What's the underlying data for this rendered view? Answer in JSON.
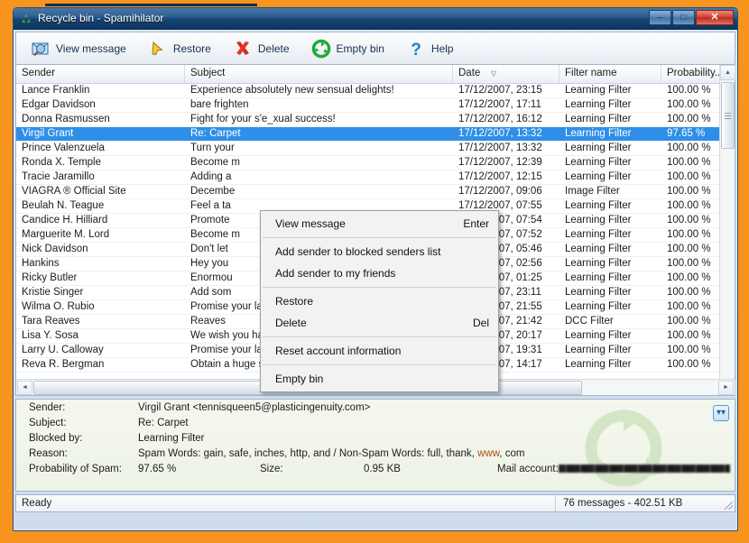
{
  "window": {
    "title": "Recycle bin - Spamihilator",
    "icon": "recycle-icon",
    "minimize": "–",
    "maximize": "□",
    "close": "✕"
  },
  "toolbar": {
    "buttons": [
      {
        "label": "View message",
        "icon": "view-message-icon"
      },
      {
        "label": "Restore",
        "icon": "restore-arrow-icon"
      },
      {
        "label": "Delete",
        "icon": "delete-x-icon"
      },
      {
        "label": "Empty bin",
        "icon": "empty-bin-recycle-icon"
      },
      {
        "label": "Help",
        "icon": "help-question-icon"
      }
    ]
  },
  "list": {
    "columns": [
      {
        "key": "sender",
        "label": "Sender",
        "sorted": false
      },
      {
        "key": "subject",
        "label": "Subject",
        "sorted": false
      },
      {
        "key": "date",
        "label": "Date",
        "sorted": true
      },
      {
        "key": "filter",
        "label": "Filter name",
        "sorted": false
      },
      {
        "key": "probability",
        "label": "Probability...",
        "sorted": false
      }
    ],
    "rows": [
      {
        "sender": "Lance Franklin",
        "subject": "Experience absolutely new sensual delights!",
        "date": "17/12/2007, 23:15",
        "filter": "Learning Filter",
        "probability": "100.00 %",
        "selected": false
      },
      {
        "sender": "Edgar Davidson",
        "subject": "bare frighten",
        "date": "17/12/2007, 17:11",
        "filter": "Learning Filter",
        "probability": "100.00 %",
        "selected": false
      },
      {
        "sender": "Donna Rasmussen",
        "subject": "Fight for your s'e_xual success!",
        "date": "17/12/2007, 16:12",
        "filter": "Learning Filter",
        "probability": "100.00 %",
        "selected": false
      },
      {
        "sender": "Virgil Grant",
        "subject": "Re: Carpet",
        "date": "17/12/2007, 13:32",
        "filter": "Learning Filter",
        "probability": "97.65 %",
        "selected": true
      },
      {
        "sender": "Prince Valenzuela",
        "subject": "Turn your",
        "date": "17/12/2007, 13:32",
        "filter": "Learning Filter",
        "probability": "100.00 %",
        "selected": false
      },
      {
        "sender": "Ronda X. Temple",
        "subject": "Become m",
        "date": "17/12/2007, 12:39",
        "filter": "Learning Filter",
        "probability": "100.00 %",
        "selected": false
      },
      {
        "sender": "Tracie Jaramillo",
        "subject": "Adding a",
        "date": "17/12/2007, 12:15",
        "filter": "Learning Filter",
        "probability": "100.00 %",
        "selected": false
      },
      {
        "sender": "VIAGRA ® Official Site",
        "subject": "Decembe",
        "date": "17/12/2007, 09:06",
        "filter": "Image Filter",
        "probability": "100.00 %",
        "selected": false
      },
      {
        "sender": "Beulah N. Teague",
        "subject": "Feel a ta",
        "date": "17/12/2007, 07:55",
        "filter": "Learning Filter",
        "probability": "100.00 %",
        "selected": false
      },
      {
        "sender": "Candice H. Hilliard",
        "subject": "Promote",
        "date": "17/12/2007, 07:54",
        "filter": "Learning Filter",
        "probability": "100.00 %",
        "selected": false
      },
      {
        "sender": "Marguerite M. Lord",
        "subject": "Become m",
        "date": "17/12/2007, 07:52",
        "filter": "Learning Filter",
        "probability": "100.00 %",
        "selected": false
      },
      {
        "sender": "Nick Davidson",
        "subject": "Don't let",
        "date": "17/12/2007, 05:46",
        "filter": "Learning Filter",
        "probability": "100.00 %",
        "selected": false
      },
      {
        "sender": "Hankins",
        "subject": "Hey you",
        "date": "17/12/2007, 02:56",
        "filter": "Learning Filter",
        "probability": "100.00 %",
        "selected": false
      },
      {
        "sender": "Ricky Butler",
        "subject": "Enormou",
        "date": "17/12/2007, 01:25",
        "filter": "Learning Filter",
        "probability": "100.00 %",
        "selected": false
      },
      {
        "sender": "Kristie Singer",
        "subject": "Add som",
        "date": "17/12/2007, 23:11",
        "filter": "Learning Filter",
        "probability": "100.00 %",
        "selected": false
      },
      {
        "sender": "Wilma O. Rubio",
        "subject": "Promise your lady, that your dik will satisfy her better in new …",
        "date": "16/12/2007, 21:55",
        "filter": "Learning Filter",
        "probability": "100.00 %",
        "selected": false
      },
      {
        "sender": "Tara Reaves",
        "subject": "Reaves",
        "date": "16/12/2007, 21:42",
        "filter": "DCC Filter",
        "probability": "100.00 %",
        "selected": false
      },
      {
        "sender": "Lisa Y. Sosa",
        "subject": "We wish you happy s'e_xual life in new year",
        "date": "16/12/2007, 20:17",
        "filter": "Learning Filter",
        "probability": "100.00 %",
        "selected": false
      },
      {
        "sender": "Larry U. Calloway",
        "subject": "Promise your lady, that your dik will satisfy her better in new …",
        "date": "16/12/2007, 19:31",
        "filter": "Learning Filter",
        "probability": "100.00 %",
        "selected": false
      },
      {
        "sender": "Reva R. Bergman",
        "subject": "Obtain a huge schlong for a new year!",
        "date": "16/12/2007, 14:17",
        "filter": "Learning Filter",
        "probability": "100.00 %",
        "selected": false
      }
    ]
  },
  "context_menu": {
    "items": [
      {
        "label": "View message",
        "accel": "Enter",
        "separator_after": true
      },
      {
        "label": "Add sender to blocked senders list",
        "accel": "",
        "separator_after": false
      },
      {
        "label": "Add sender to my friends",
        "accel": "",
        "separator_after": true
      },
      {
        "label": "Restore",
        "accel": "",
        "separator_after": false
      },
      {
        "label": "Delete",
        "accel": "Del",
        "separator_after": true
      },
      {
        "label": "Reset account information",
        "accel": "",
        "separator_after": true
      },
      {
        "label": "Empty bin",
        "accel": "",
        "separator_after": false
      }
    ]
  },
  "detail": {
    "sender_label": "Sender:",
    "sender_value": "Virgil Grant <tennisqueen5@plasticingenuity.com>",
    "subject_label": "Subject:",
    "subject_value": "Re: Carpet",
    "blocked_label": "Blocked by:",
    "blocked_value": "Learning Filter",
    "reason_label": "Reason:",
    "reason_spam": "Spam Words: gain, safe, inches, http, and / Non-Spam Words: full, thank, ",
    "reason_highlight": "www",
    "reason_tail": ", com",
    "probability_label": "Probability of Spam:",
    "probability_value": "97.65 %",
    "size_label": "Size:",
    "size_value": "0.95 KB",
    "account_label": "Mail account:",
    "account_value": "",
    "expand_icon": "chevron-double-down-icon"
  },
  "status": {
    "left": "Ready",
    "right": "76 messages - 402.51 KB"
  },
  "scrollbars": {
    "up_arrow": "▲",
    "down_arrow": "▼",
    "left_arrow": "◄",
    "right_arrow": "►"
  },
  "colors": {
    "selection": "#2f8fe8",
    "desktop": "#F7941E",
    "titlebar": "#205890",
    "highlight_word": "#b34a1a"
  }
}
